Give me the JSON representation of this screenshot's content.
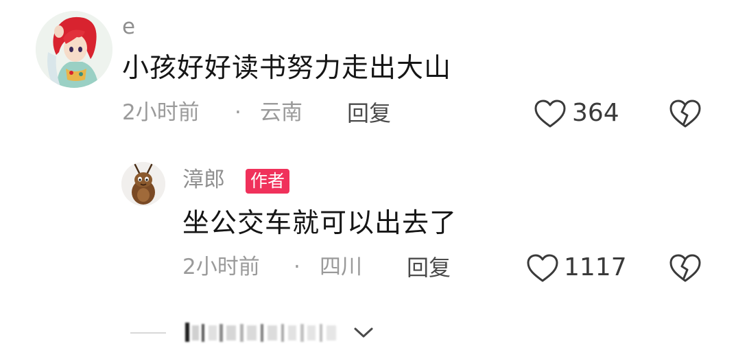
{
  "comments": [
    {
      "username": "e",
      "text": "小孩好好读书努力走出大山",
      "time": "2小时前",
      "separator": "·",
      "location": "云南",
      "reply_label": "回复",
      "like_count": "364"
    },
    {
      "username": "漳郎",
      "badge": "作者",
      "text": "坐公交车就可以出去了",
      "time": "2小时前",
      "separator": "·",
      "location": "四川",
      "reply_label": "回复",
      "like_count": "1117"
    }
  ],
  "icons": {
    "like": "heart-outline-icon",
    "dislike": "broken-heart-icon",
    "expand": "chevron-down-icon"
  },
  "colors": {
    "badge_bg": "#f0315b",
    "meta_text": "#9a9a9a",
    "body_text": "#151515"
  }
}
